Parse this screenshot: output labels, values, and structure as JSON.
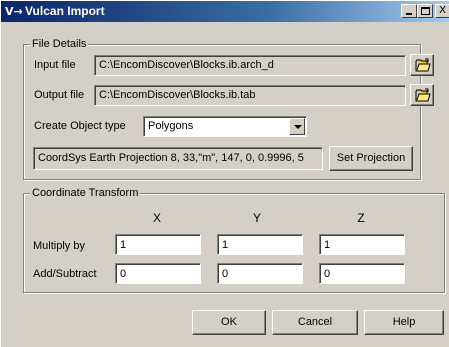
{
  "window": {
    "title": "Vulcan Import",
    "icon_text": "V→",
    "icon": "vulcan-app-icon",
    "minimize_icon": "minimize-icon",
    "maximize_icon": "maximize-icon",
    "close_glyph": "X"
  },
  "file_details": {
    "group_label": "File Details",
    "input_file_label": "Input file",
    "input_file_value": "C:\\EncomDiscover\\Blocks.ib.arch_d",
    "output_file_label": "Output file",
    "output_file_value": "C:\\EncomDiscover\\Blocks.ib.tab",
    "browse_icon": "open-folder-icon",
    "object_type_label": "Create Object type",
    "object_type_value": "Polygons",
    "projection_value": "CoordSys Earth Projection 8, 33,\"m\", 147, 0, 0.9996, 5",
    "set_projection_label": "Set Projection"
  },
  "coordinate_transform": {
    "group_label": "Coordinate Transform",
    "axis_x": "X",
    "axis_y": "Y",
    "axis_z": "Z",
    "multiply_label": "Multiply by",
    "multiply": {
      "x": "1",
      "y": "1",
      "z": "1"
    },
    "add_label": "Add/Subtract",
    "add": {
      "x": "0",
      "y": "0",
      "z": "0"
    }
  },
  "buttons": {
    "ok": "OK",
    "cancel": "Cancel",
    "help": "Help"
  }
}
